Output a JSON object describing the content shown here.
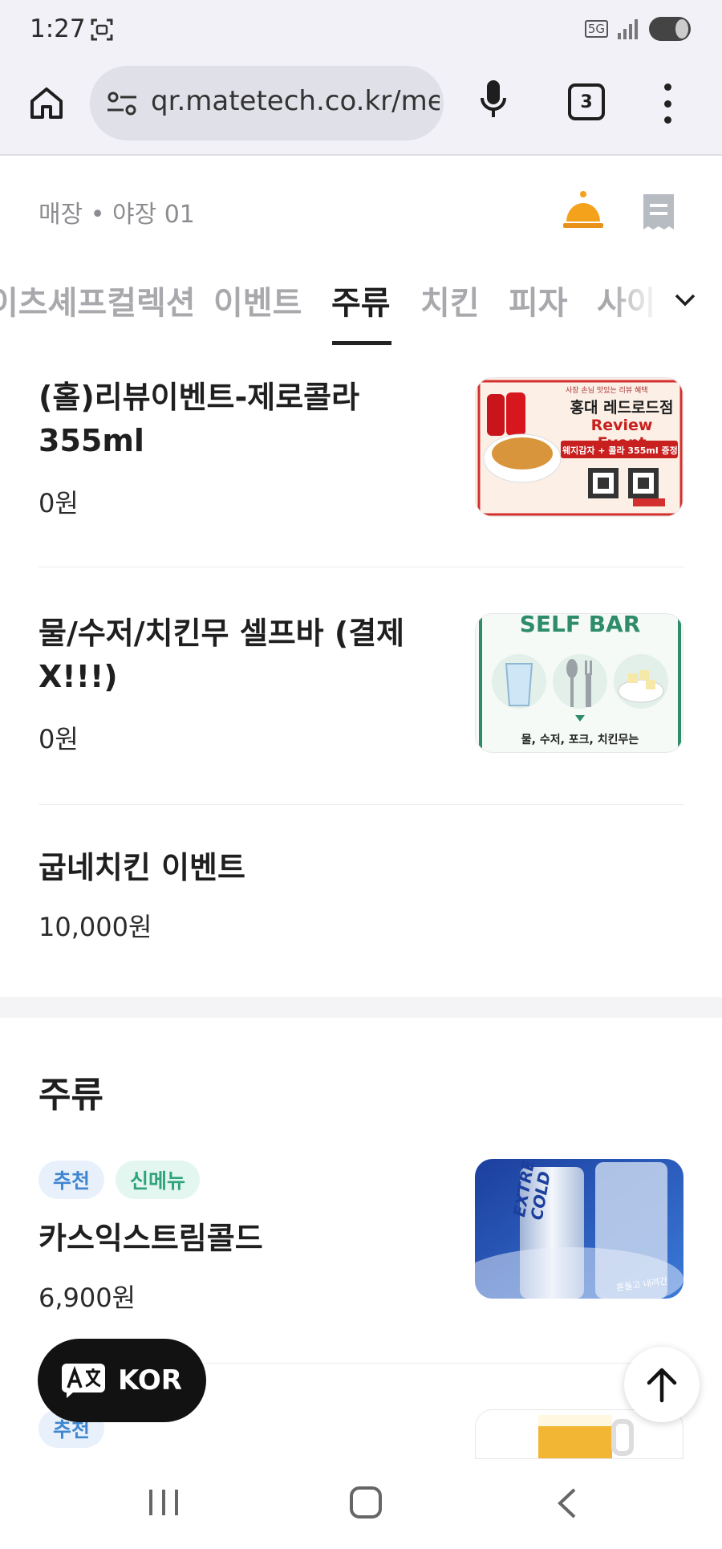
{
  "status_bar": {
    "time": "1:27",
    "network": "5G"
  },
  "browser": {
    "url": "qr.matetech.co.kr/me",
    "tab_count": "3"
  },
  "store": {
    "label": "매장 • 야장 01"
  },
  "categories": {
    "tabs": [
      "이츠셰프컬렉션",
      "이벤트",
      "주류",
      "치킨",
      "피자",
      "사이"
    ],
    "active": "주류"
  },
  "items": [
    {
      "name": "(홀)리뷰이벤트-제로콜라 355ml",
      "price": "0원",
      "thumb": {
        "top_note": "사장 손님 맛있는 리뷰 혜택",
        "title": "홍대 레드로드점",
        "event": "Review Event",
        "bar": "웨지감자 + 콜라 355ml 증정"
      }
    },
    {
      "name": "물/수저/치킨무 셀프바 (결제X!!!)",
      "price": "0원",
      "thumb": {
        "title": "SELF BAR",
        "caption": "물, 수저, 포크, 치킨무는"
      }
    },
    {
      "name": "굽네치킨 이벤트",
      "price": "10,000원"
    }
  ],
  "section": {
    "title": "주류",
    "items": [
      {
        "badges": [
          "추천",
          "신메뉴"
        ],
        "name": "카스익스트림콜드",
        "price": "6,900원",
        "thumb": {
          "brand_text": "EXTREME COLD",
          "corner_text": "흔들고 내려간"
        }
      },
      {
        "badges": [
          "추천"
        ]
      }
    ]
  },
  "floating": {
    "language_label": "KOR"
  },
  "colors": {
    "accent_bell": "#f4a11c",
    "badge_blue": "#3f86cf",
    "badge_green": "#2fa37d"
  }
}
